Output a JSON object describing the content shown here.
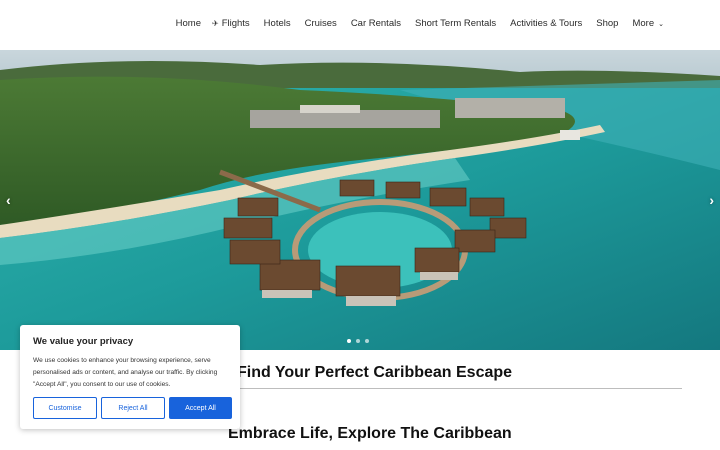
{
  "nav": {
    "items": [
      {
        "glyph": "",
        "label": "Home"
      },
      {
        "glyph": "✈",
        "label": "Flights"
      },
      {
        "glyph": "",
        "label": "Hotels"
      },
      {
        "glyph": "",
        "label": "Cruises"
      },
      {
        "glyph": "",
        "label": "Car Rentals"
      },
      {
        "glyph": "",
        "label": "Short Term Rentals"
      },
      {
        "glyph": "",
        "label": "Activities & Tours"
      },
      {
        "glyph": "",
        "label": "Shop"
      },
      {
        "glyph": "",
        "label": "More",
        "caret": "⌄"
      }
    ]
  },
  "hero": {
    "prev_arrow": "‹",
    "next_arrow": "›",
    "slide_count": 3,
    "active_slide": 1
  },
  "headings": {
    "primary": "Find Your Perfect Caribbean Escape",
    "secondary": "Embrace Life, Explore The Caribbean"
  },
  "cookie": {
    "title": "We value your privacy",
    "text": "We use cookies to enhance your browsing experience, serve personalised ads or content, and analyse our traffic. By clicking \"Accept All\", you consent to our use of cookies.",
    "customise": "Customise",
    "reject": "Reject All",
    "accept": "Accept All"
  },
  "colors": {
    "accent": "#1863dc",
    "sea": "#1f9c9a",
    "forest": "#3e6b2c"
  }
}
